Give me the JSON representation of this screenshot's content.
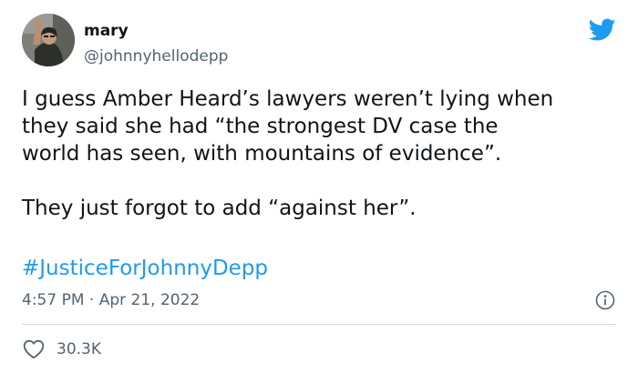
{
  "tweet": {
    "author": {
      "name": "mary",
      "handle": "@johnnyhellodepp",
      "avatar_icon": "person-raised-fist-photo"
    },
    "brand_icon": "twitter-bird-icon",
    "brand_color": "#1d9bf0",
    "text_lines": [
      "I guess Amber Heard’s lawyers weren’t lying when",
      "they said she had “the strongest DV case the",
      "world has seen, with mountains of evidence”."
    ],
    "text_line_2": "They just forgot to add “against her”.",
    "hashtag": "#JusticeForJohnnyDepp",
    "hashtag_color": "#1d9bf0",
    "timestamp": "4:57 PM · Apr 21, 2022",
    "info_icon": "info-circle-icon",
    "likes": {
      "icon": "heart-outline-icon",
      "count": "30.3K"
    }
  }
}
